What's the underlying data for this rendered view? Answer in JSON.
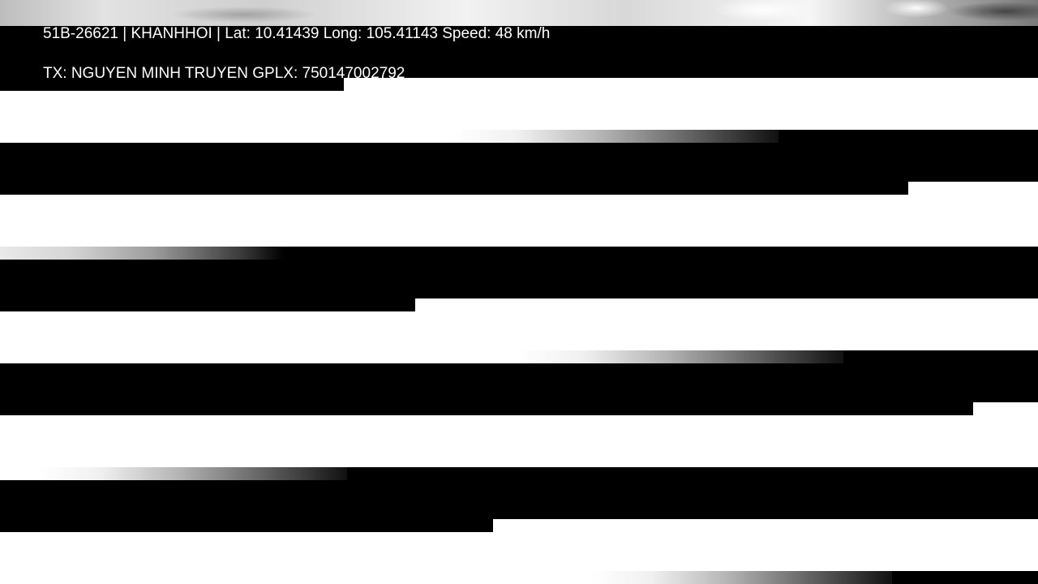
{
  "overlay": {
    "line1": "51B-26621 | KHANHHOI | Lat: 10.41439 Long: 105.41143 Speed: 48 km/h",
    "line2": "TX: NGUYEN MINH TRUYEN GPLX: 750147002792"
  },
  "colors": {
    "text": "#ffffff",
    "band_light": "#ffffff",
    "band_dark": "#000000"
  }
}
